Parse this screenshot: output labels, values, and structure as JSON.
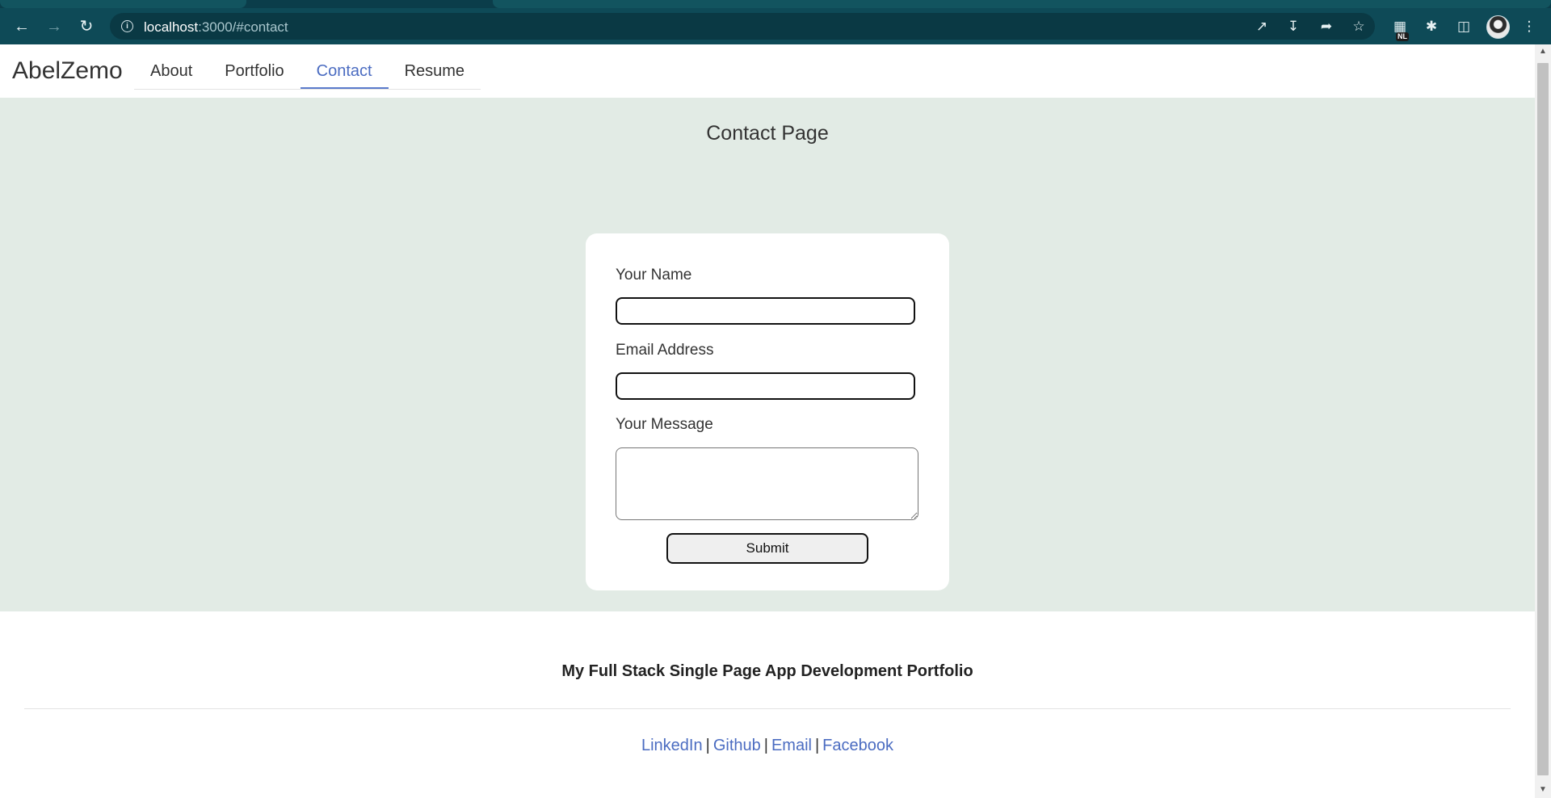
{
  "browser": {
    "url_host": "localhost",
    "url_rest": ":3000/#contact",
    "extension_badge": "NL",
    "icons": [
      "back-arrow-icon",
      "forward-arrow-icon",
      "reload-icon",
      "info-icon",
      "open-in-app-icon",
      "install-icon",
      "share-icon",
      "star-icon",
      "extension-icon",
      "puzzle-icon",
      "side-panel-icon",
      "avatar",
      "menu-kebab-icon"
    ]
  },
  "nav": {
    "brand": "AbelZemo",
    "tabs": [
      {
        "label": "About",
        "active": false
      },
      {
        "label": "Portfolio",
        "active": false
      },
      {
        "label": "Contact",
        "active": true
      },
      {
        "label": "Resume",
        "active": false
      }
    ],
    "accent_color": "#4b6cc1"
  },
  "contact": {
    "title": "Contact Page",
    "background": "#e2ebe5",
    "name_label": "Your Name",
    "name_value": "",
    "email_label": "Email Address",
    "email_value": "",
    "message_label": "Your Message",
    "message_value": "",
    "submit_label": "Submit"
  },
  "footer": {
    "title": "My Full Stack Single Page App Development Portfolio",
    "links": [
      "LinkedIn",
      "Github",
      "Email",
      "Facebook"
    ],
    "separator": "|"
  }
}
